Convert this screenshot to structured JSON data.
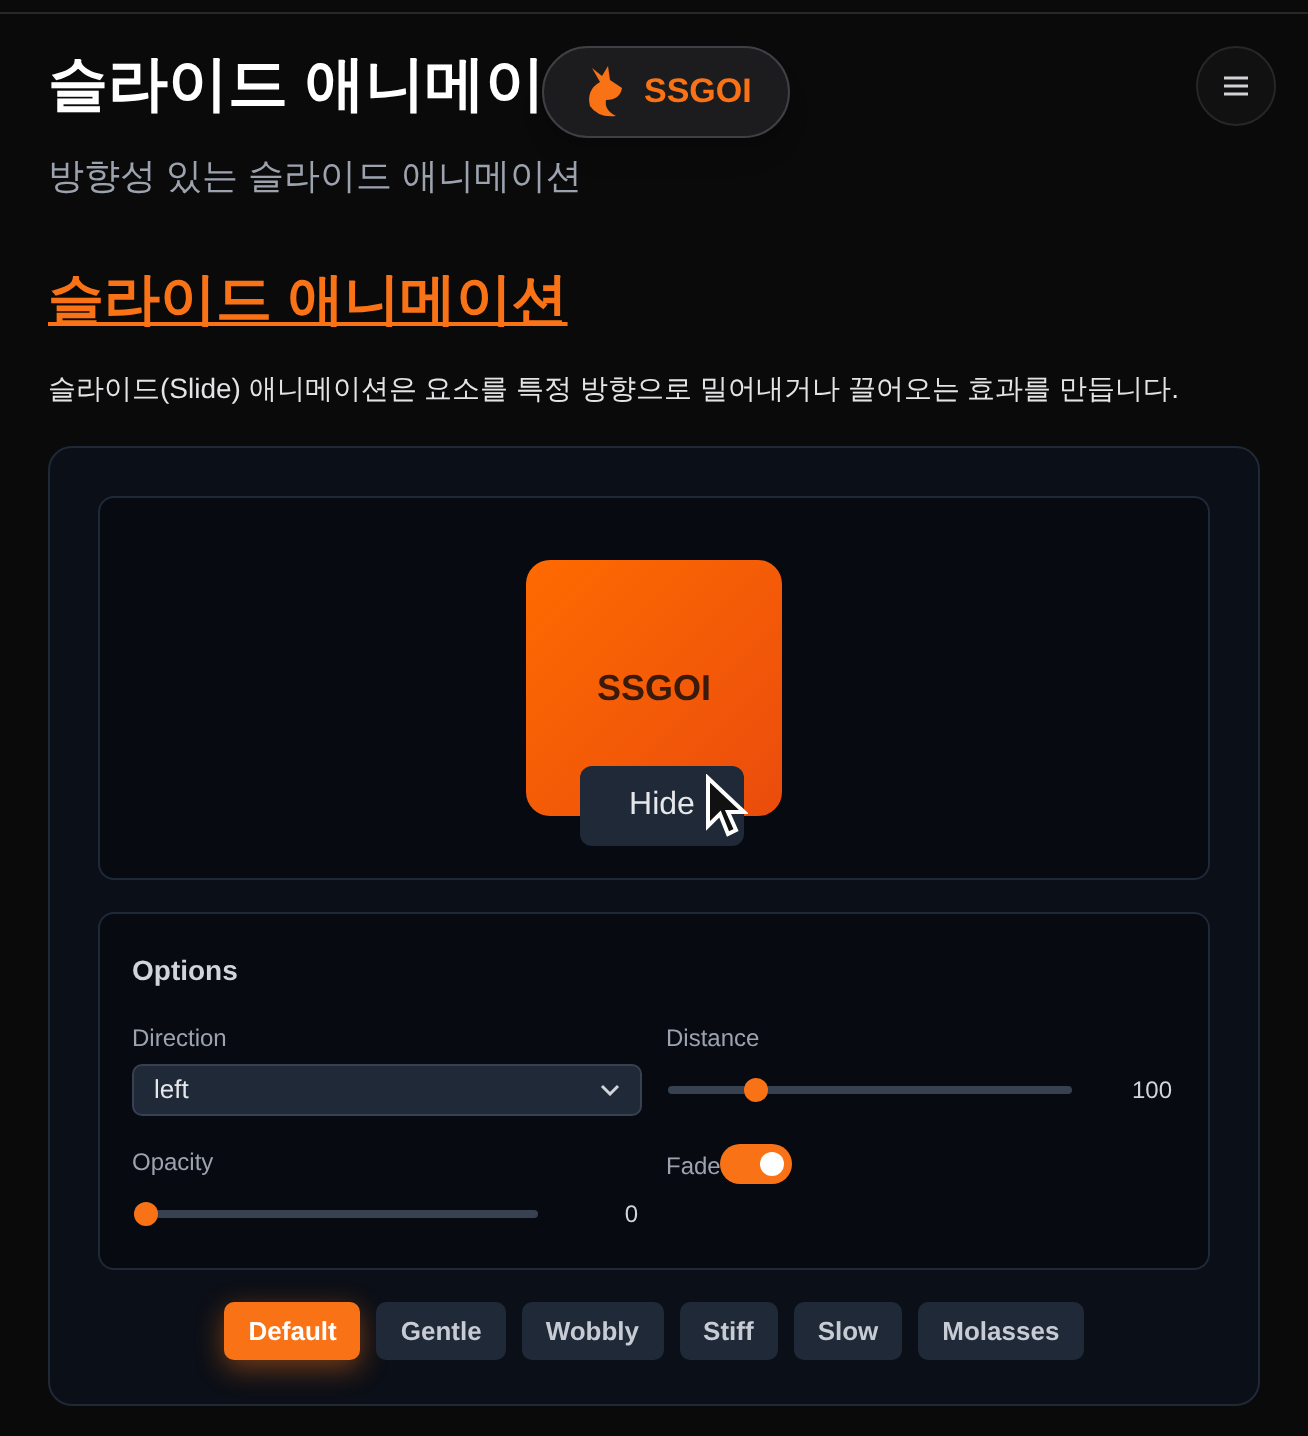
{
  "header": {
    "title": "슬라이드 애니메이",
    "subtitle": "방향성 있는 슬라이드 애니메이션",
    "logo_text": "SSGOI"
  },
  "section": {
    "heading": "슬라이드 애니메이션",
    "description": "슬라이드(Slide) 애니메이션은 요소를 특정 방향으로 밀어내거나 끌어오는 효과를 만듭니다."
  },
  "preview": {
    "box_text": "SSGOI",
    "button": "Hide"
  },
  "options": {
    "title": "Options",
    "controls": [
      {
        "kind": "select",
        "label": "Direction",
        "value": "left"
      },
      {
        "kind": "slider",
        "label": "Distance",
        "level": 0.22,
        "reading": "100"
      },
      {
        "kind": "slider",
        "label": "Opacity",
        "level": 0,
        "reading": "0"
      },
      {
        "kind": "toggle",
        "label": "Fade",
        "on": true
      }
    ]
  },
  "presets": [
    {
      "label": "Default",
      "selected": true
    },
    {
      "label": "Gentle",
      "selected": false
    },
    {
      "label": "Wobbly",
      "selected": false
    },
    {
      "label": "Stiff",
      "selected": false
    },
    {
      "label": "Slow",
      "selected": false
    },
    {
      "label": "Molasses",
      "selected": false
    }
  ]
}
